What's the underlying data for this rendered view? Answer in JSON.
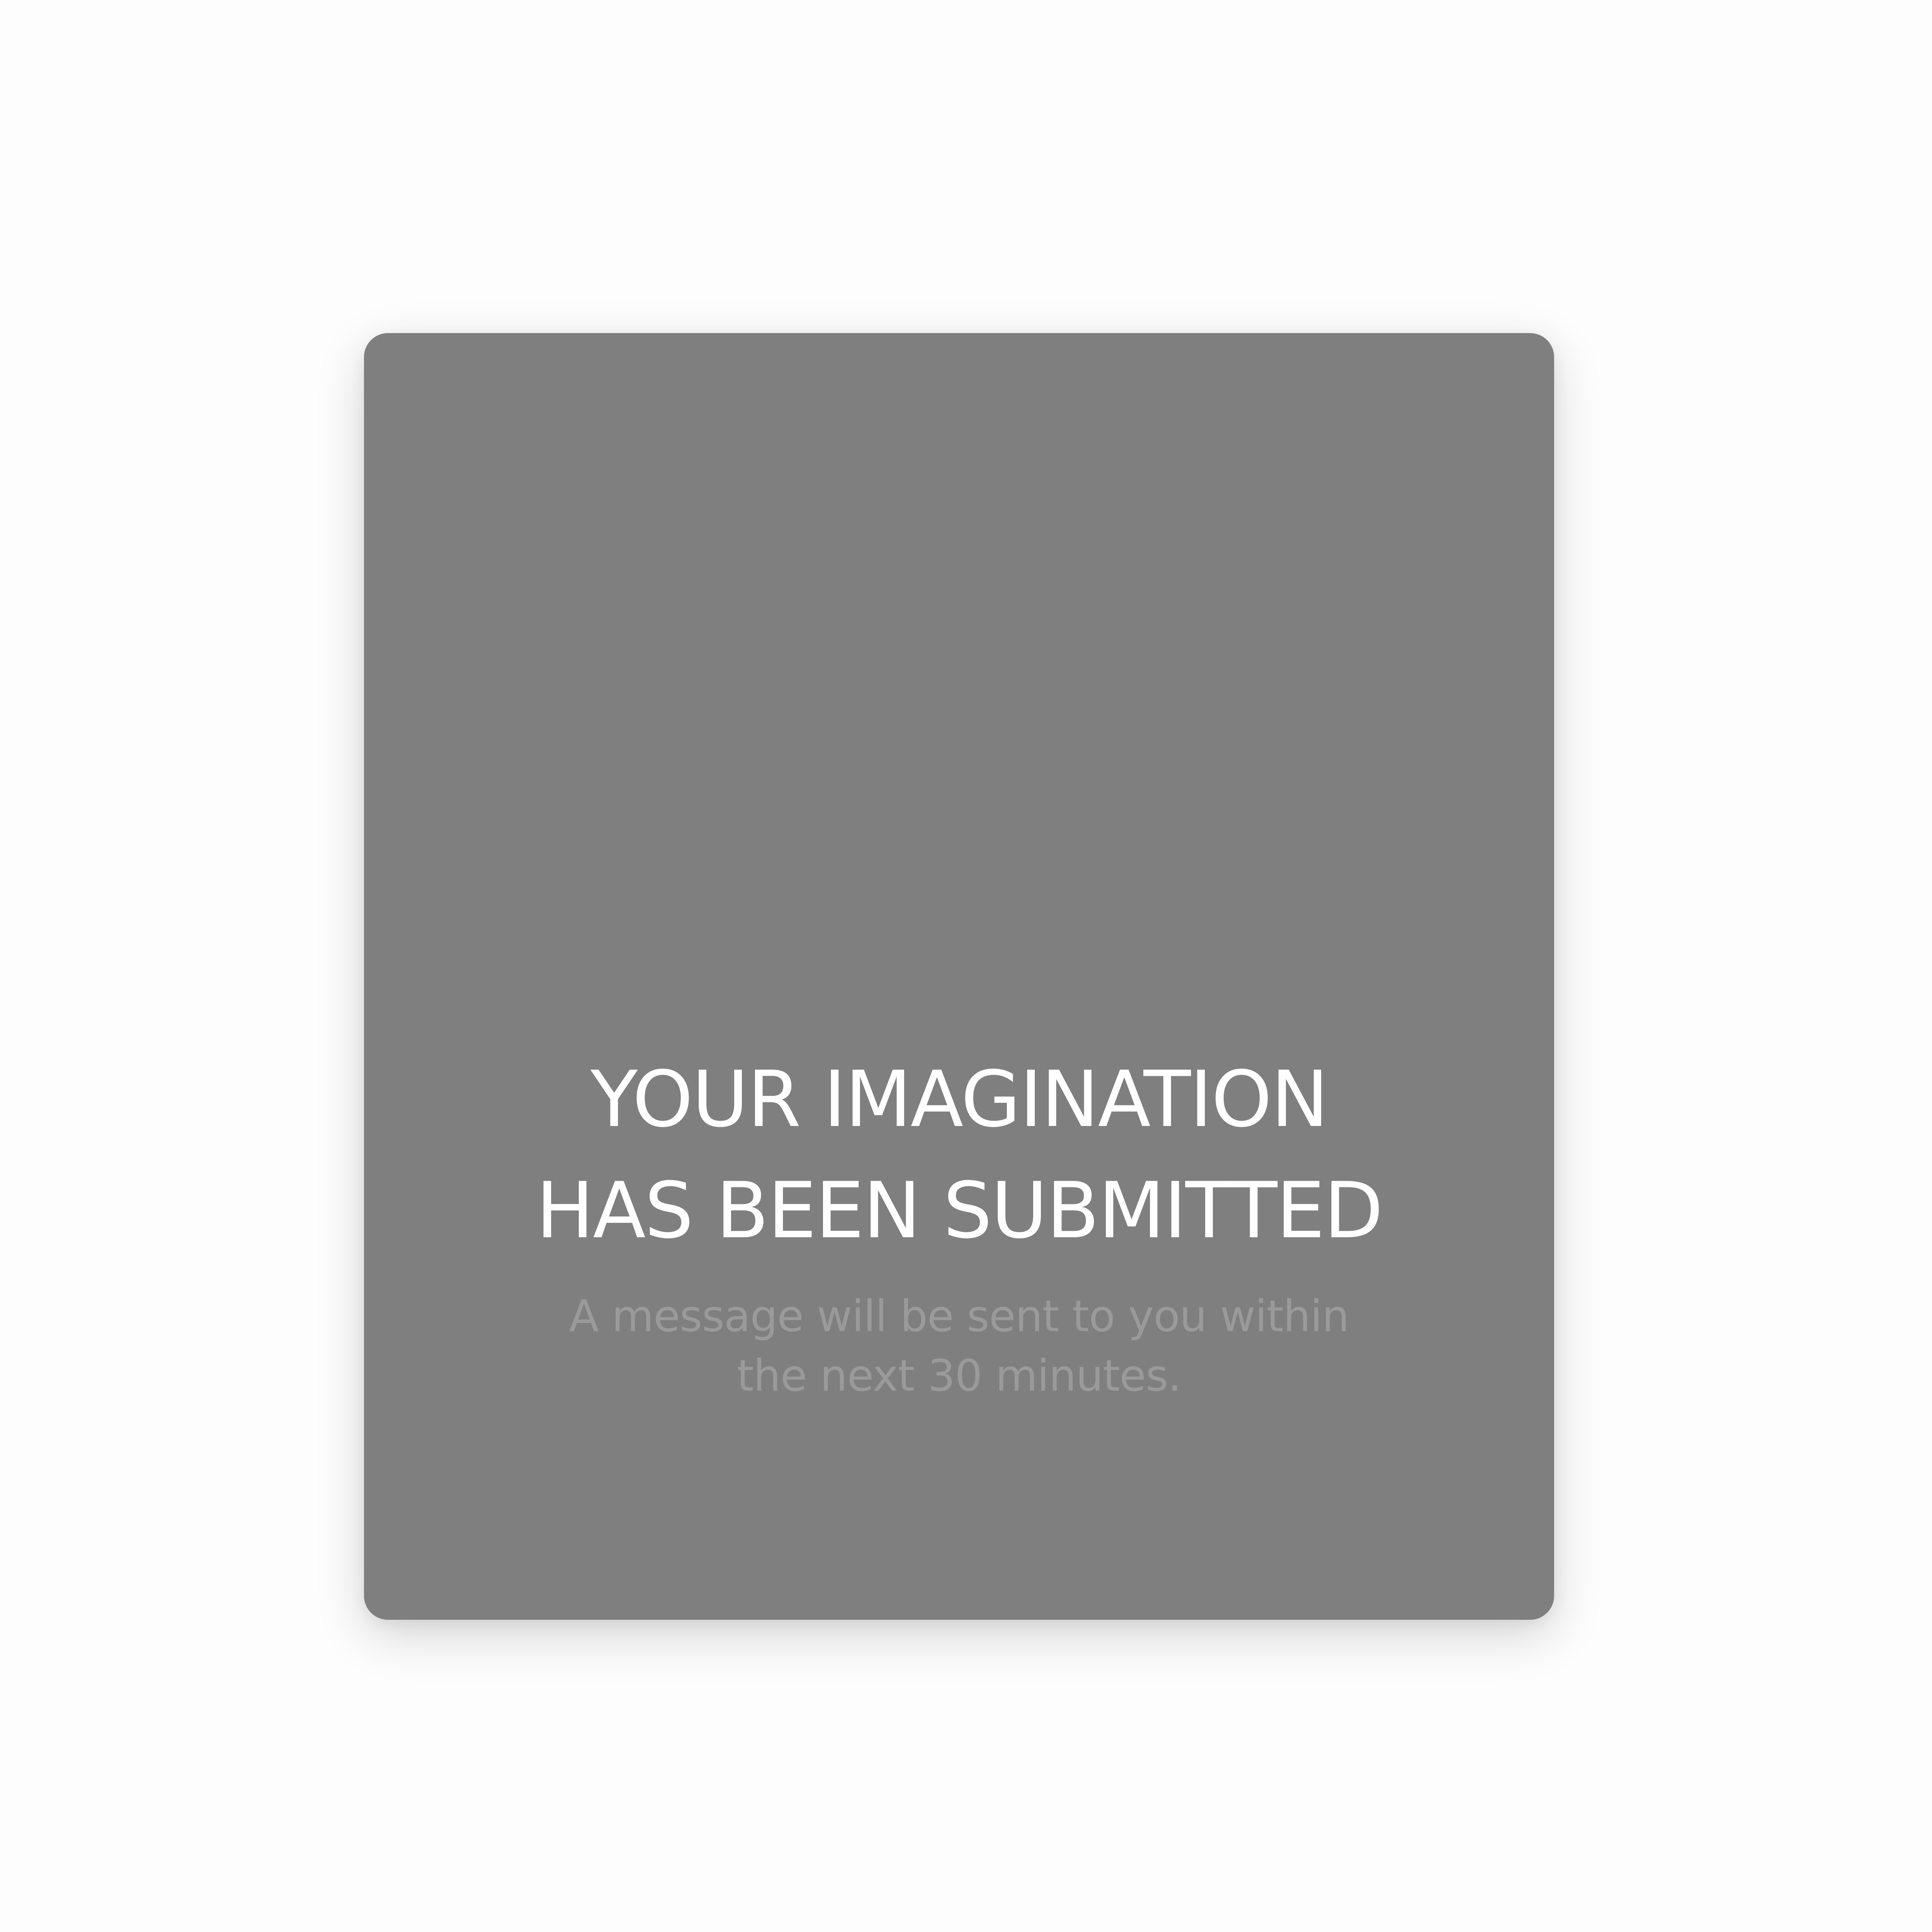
{
  "confirmation": {
    "headline_lines": [
      "YOUR IMAGINATION",
      "HAS BEEN SUBMITTED"
    ],
    "message_lines": [
      "A message will be sent to you within",
      "the next 30 minutes."
    ]
  },
  "colors": {
    "page_background": "#fdfdfd",
    "card_background": "#7f7f7f",
    "headline_text": "#ffffff",
    "message_text": "#9a9a9a"
  }
}
